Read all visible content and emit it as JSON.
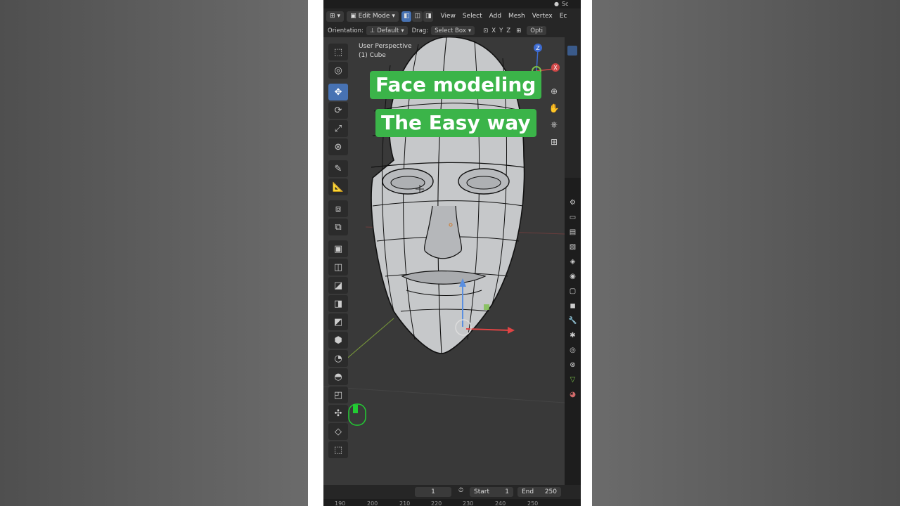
{
  "header": {
    "mode_label": "Edit Mode",
    "menus": [
      "View",
      "Select",
      "Add",
      "Mesh",
      "Vertex",
      "Ec"
    ],
    "scene_partial": "Sc",
    "orientation_label": "Orientation:",
    "orientation_value": "Default",
    "drag_label": "Drag:",
    "drag_value": "Select Box",
    "axes": [
      "X",
      "Y",
      "Z"
    ],
    "options_partial": "Opti"
  },
  "viewport": {
    "view_name": "User Perspective",
    "object_name": "(1) Cube",
    "gizmo_z": "Z",
    "gizmo_x": "X"
  },
  "overlay_titles": {
    "line1": "Face modeling",
    "line2": "The Easy way",
    "background_color": "#3bb449"
  },
  "toolbar_icons": [
    "select-box-icon",
    "cursor-icon",
    "move-icon",
    "rotate-icon",
    "scale-icon",
    "transform-icon",
    "annotate-icon",
    "measure-icon",
    "add-cube-icon",
    "extrude-icon",
    "inset-icon",
    "bevel-icon",
    "loop-cut-icon",
    "knife-icon",
    "poly-build-icon",
    "spin-icon",
    "smooth-icon",
    "edge-slide-icon",
    "shrink-fatten-icon",
    "shear-icon",
    "rip-icon"
  ],
  "timeline": {
    "current_frame": "1",
    "start_label": "Start",
    "start_value": "1",
    "end_label": "End",
    "end_value": "250",
    "ruler_ticks": [
      "190",
      "200",
      "210",
      "220",
      "230",
      "240",
      "250"
    ]
  },
  "colors": {
    "accent": "#4772b3",
    "mouse_indicator": "#22cc33"
  }
}
